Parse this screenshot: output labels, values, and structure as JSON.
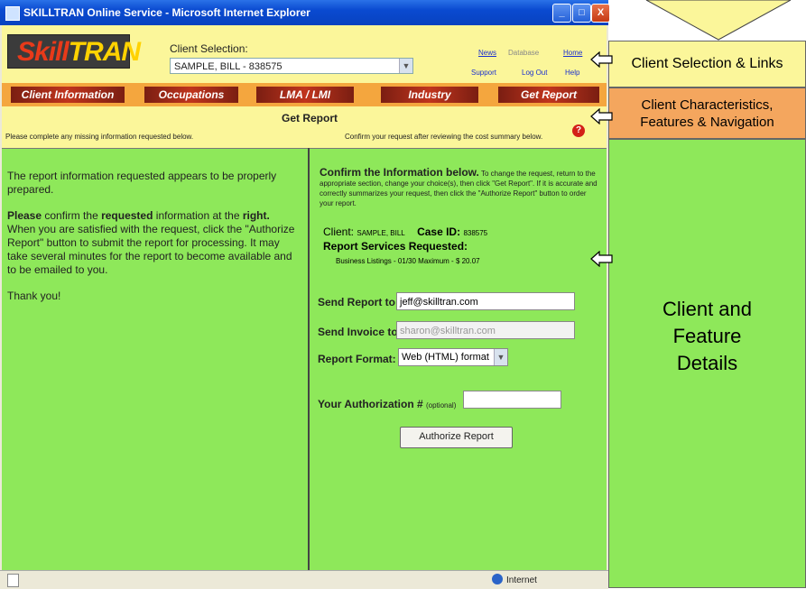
{
  "window": {
    "title": "SKILLTRAN Online Service - Microsoft Internet Explorer",
    "buttons": [
      "_",
      "□",
      "X"
    ]
  },
  "header": {
    "logo_parts": [
      "Skill",
      "TRAN"
    ],
    "client_selection_label": "Client Selection:",
    "client_selection_value": "SAMPLE, BILL - 838575",
    "links_row1": [
      "News",
      "Database",
      "Home"
    ],
    "links_row2": [
      "Support",
      "Log Out",
      "Help"
    ]
  },
  "nav": {
    "tabs": [
      "Client Information",
      "Occupations",
      "LMA / LMI",
      "Industry",
      "Get Report"
    ]
  },
  "report_bar": {
    "title": "Get Report",
    "left_note": "Please complete any missing information requested below.",
    "right_note": "Confirm your request after reviewing the cost summary below."
  },
  "left_panel": {
    "para1": "The report information requested appears to be properly prepared.",
    "para2_bold": "Please",
    "para2_mid": " confirm the ",
    "para2_bold2": "requested",
    "para2_mid2": " information at the ",
    "para2_bold3": "right.",
    "para2_rest": " When you are satisfied with the request, click the \"Authorize Report\" button to submit the report for processing. It may take several minutes for the report to become available and to be emailed to you.",
    "para3": "Thank you!"
  },
  "right_panel": {
    "confirm_heading": "Confirm the Information below.",
    "confirm_text": " To change the request, return to the appropriate section, change your choice(s), then click \"Get Report\". If it is accurate and correctly summarizes your request, then click the \"Authorize Report\" button to order your report.",
    "client_label": "Client:",
    "client_value": "SAMPLE, BILL",
    "case_label": "Case ID:",
    "case_value": "838575",
    "services_label": "Report Services Requested:",
    "services_value": "Business Listings - 01/30 Maximum - $ 20.07",
    "send_report_label": "Send Report to:",
    "send_report_value": "jeff@skilltran.com",
    "send_invoice_label": "Send Invoice to:",
    "send_invoice_value": "sharon@skilltran.com",
    "format_label": "Report Format:",
    "format_value": "Web (HTML) format",
    "auth_label": "Your Authorization #",
    "auth_optional": "(optional)",
    "auth_value": "",
    "authorize_button": "Authorize Report"
  },
  "statusbar": {
    "zone": "Internet"
  },
  "annotations": {
    "a1": "Client Selection & Links",
    "a2_line1": "Client Characteristics,",
    "a2_line2": "Features & Navigation",
    "a3_line1": "Client and",
    "a3_line2": "Feature",
    "a3_line3": "Details"
  },
  "colors": {
    "yellow": "#fbf69a",
    "orange": "#f4a65e",
    "green": "#8ee85a",
    "nav_red": "#c0341d",
    "title_blue": "#0a4ad0"
  }
}
